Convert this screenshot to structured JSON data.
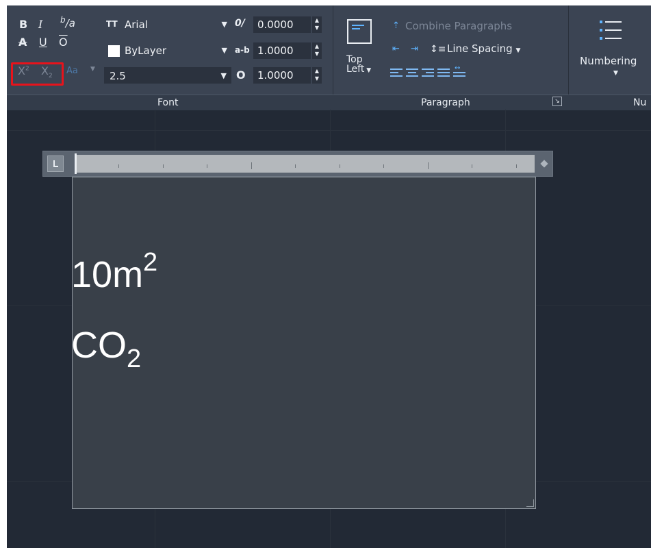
{
  "ribbon": {
    "font_group": {
      "label": "Font",
      "bold": "B",
      "italic": "I",
      "stack_top": "b",
      "stack_slash": "/",
      "stack_bottom": "a",
      "strikethrough": "A",
      "underline": "U",
      "overline": "O",
      "superscript_base": "X",
      "superscript_mark": "2",
      "subscript_base": "X",
      "subscript_mark": "2",
      "change_case": "Aa",
      "font_icon": "TT",
      "font_value": "Arial",
      "color_value": "ByLayer",
      "height_value": "2.5",
      "oblique_icon": "0/",
      "oblique_value": "0.0000",
      "tracking_icon": "a-b",
      "tracking_value": "1.0000",
      "width_icon": "O",
      "width_value": "1.0000"
    },
    "paragraph_group": {
      "label": "Paragraph",
      "justification_line1": "Top",
      "justification_line2": "Left",
      "combine_paragraphs": "Combine Paragraphs",
      "line_spacing": "Line Spacing"
    },
    "numbering_group": {
      "label": "Nu",
      "numbering_button": "Numbering"
    }
  },
  "editor": {
    "line1_base": "10m",
    "line1_superscript": "2",
    "line2_base": "CO",
    "line2_subscript": "2"
  },
  "colors": {
    "ribbon_bg": "#3b4453",
    "canvas_bg": "#222935",
    "highlight": "#e8131b",
    "accent_blue": "#5fb4ff"
  }
}
